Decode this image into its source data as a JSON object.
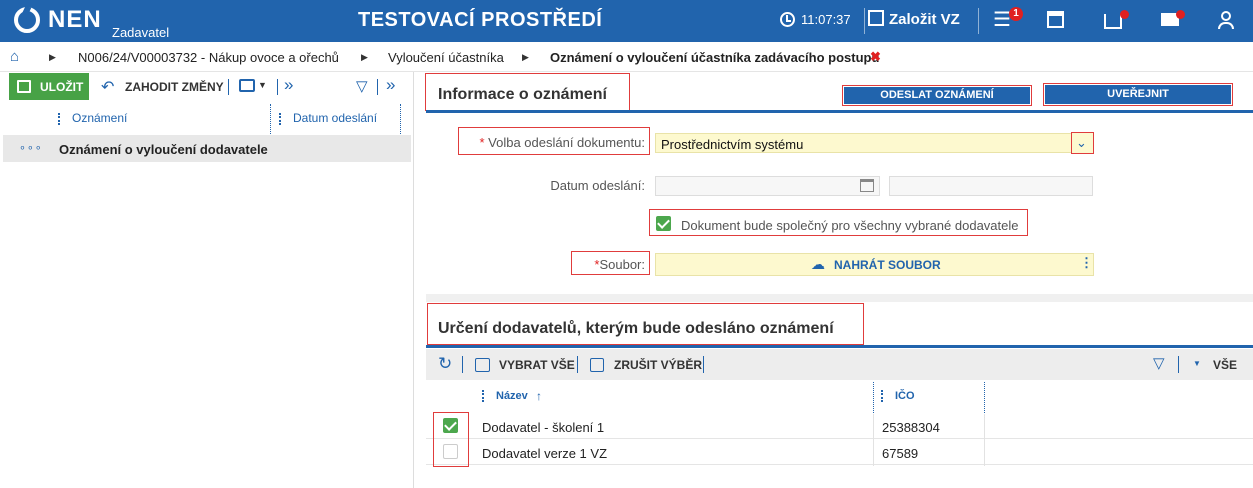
{
  "topbar": {
    "logo": "NEN",
    "logo_sub": "Zadavatel",
    "env_title": "TESTOVACÍ PROSTŘEDÍ",
    "clock": "11:07:37",
    "create_label": "Založit VZ",
    "menu_badge": "1"
  },
  "breadcrumb": {
    "items": [
      "N006/24/V00003732 - Nákup ovoce a ořechů",
      "Vyloučení účastníka",
      "Oznámení o vyloučení účastníka zadávacího postupu"
    ],
    "close": "✖"
  },
  "left": {
    "save_label": "ULOŽIT",
    "discard_label": "ZAHODIT ZMĚNY",
    "columns": [
      "Oznámení",
      "Datum odeslání"
    ],
    "rows": [
      {
        "icon": "∘∘∘",
        "label": "Oznámení o vyloučení dodavatele"
      }
    ]
  },
  "info": {
    "title": "Informace o oznámení",
    "send_button": "ODESLAT OZNÁMENÍ",
    "publish_button": "UVEŘEJNIT",
    "volba_label": "Volba odeslání dokumentu:",
    "volba_value": "Prostřednictvím systému",
    "datum_label": "Datum odeslání:",
    "common_doc_label": "Dokument bude společný pro všechny vybrané dodavatele",
    "common_doc_checked": true,
    "soubor_label": "Soubor:",
    "upload_label": "NAHRÁT SOUBOR",
    "required_mark": "*"
  },
  "suppliers": {
    "title": "Určení dodavatelů, kterým bude odesláno oznámení",
    "select_all": "VYBRAT VŠE",
    "clear_selection": "ZRUŠIT VÝBĚR",
    "all_label": "VŠE",
    "columns": {
      "name": "Název",
      "ico": "IČO"
    },
    "sort_arrow": "↑",
    "rows": [
      {
        "name": "Dodavatel - školení 1",
        "ico": "25388304",
        "checked": true
      },
      {
        "name": "Dodavatel verze 1 VZ",
        "ico": "67589",
        "checked": false
      }
    ]
  }
}
